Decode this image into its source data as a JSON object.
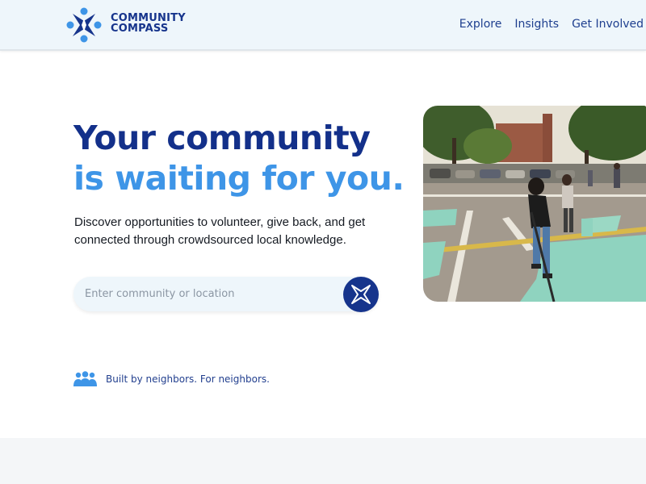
{
  "brand": {
    "line1": "COMMUNITY",
    "line2": "COMPASS",
    "logo_icon": "compass-star-icon"
  },
  "nav": {
    "items": [
      "Explore",
      "Insights",
      "Get Involved"
    ]
  },
  "hero": {
    "headline_line1": "Your community",
    "headline_line2": "is waiting for you.",
    "subtext": "Discover opportunities to volunteer, give back, and get connected through crowdsourced local knowledge."
  },
  "search": {
    "placeholder": "Enter community or location",
    "value": "",
    "button_icon": "compass-star-icon"
  },
  "tagline": {
    "text": "Built by neighbors. For neighbors.",
    "icon": "people-group-icon"
  },
  "photo": {
    "subject": "volunteers-painting-street-mural-icon"
  },
  "colors": {
    "navy": "#16348c",
    "sky": "#3e95e7",
    "header_bg": "#eef6fb",
    "mint": "#8fd3bf"
  }
}
